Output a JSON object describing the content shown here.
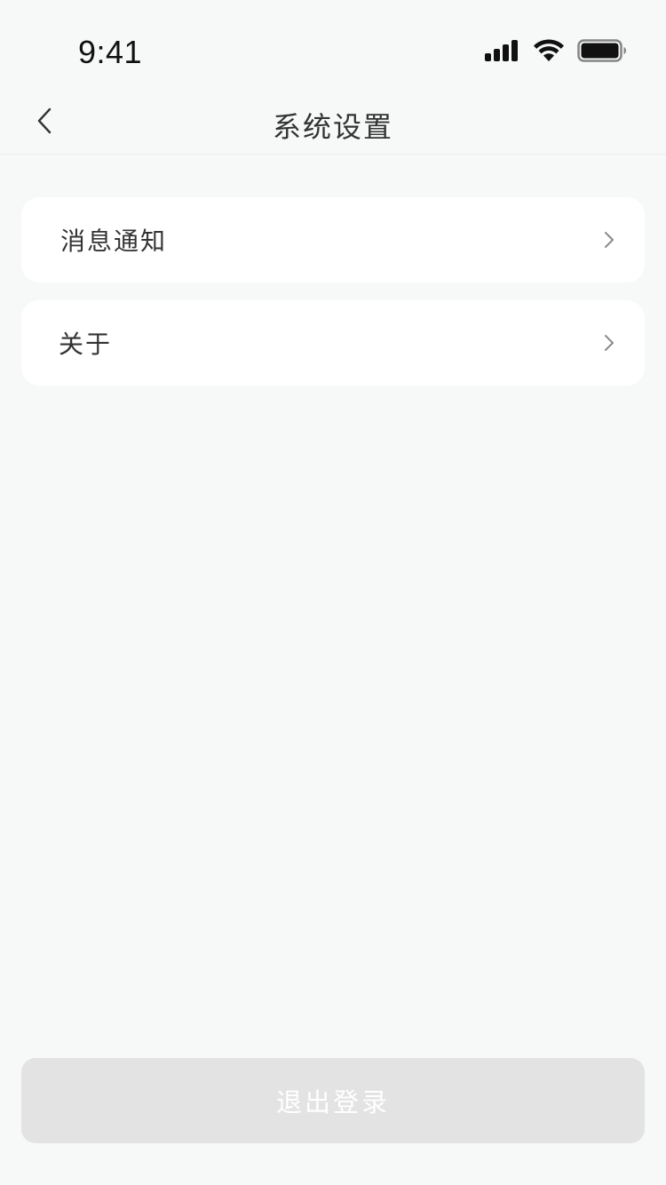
{
  "status_bar": {
    "time": "9:41",
    "icons": [
      "signal-icon",
      "wifi-icon",
      "battery-icon"
    ]
  },
  "nav": {
    "back_icon": "chevron-left-icon",
    "title": "系统设置"
  },
  "menu": {
    "items": [
      {
        "label": "消息通知",
        "icon": "chevron-right-icon"
      },
      {
        "label": "关于",
        "icon": "chevron-right-icon"
      }
    ]
  },
  "footer": {
    "logout_label": "退出登录"
  },
  "colors": {
    "background": "#f7f8f8",
    "card": "#ffffff",
    "text": "#333333",
    "chevron": "#8a8a8a",
    "logout_bg": "#e3e3e3",
    "logout_text": "#ffffff"
  }
}
